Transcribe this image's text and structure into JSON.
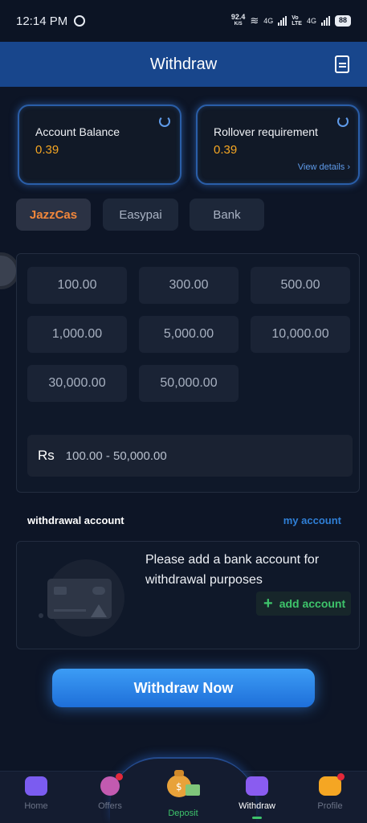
{
  "status_bar": {
    "time": "12:14 PM",
    "speed_value": "92.4",
    "speed_unit": "K/S",
    "net1": "4G",
    "net2_top": "Vo",
    "net2_bottom": "LTE",
    "net3": "4G",
    "battery": "88"
  },
  "header": {
    "title": "Withdraw"
  },
  "balances": {
    "account_label": "Account Balance",
    "account_value": "0.39",
    "rollover_label": "Rollover requirement",
    "rollover_value": "0.39",
    "view_details": "View details ›"
  },
  "methods": [
    "JazzCas",
    "Easypai",
    "Bank"
  ],
  "amounts": [
    "100.00",
    "300.00",
    "500.00",
    "1,000.00",
    "5,000.00",
    "10,000.00",
    "30,000.00",
    "50,000.00"
  ],
  "range": {
    "currency": "Rs",
    "text": "100.00 - 50,000.00"
  },
  "withdrawal_account": {
    "label": "withdrawal account",
    "link": "my account",
    "message": "Please add a bank account for withdrawal purposes",
    "add_button": "add account"
  },
  "cta": {
    "label": "Withdraw Now"
  },
  "nav": {
    "home": "Home",
    "offers": "Offers",
    "deposit": "Deposit",
    "withdraw": "Withdraw",
    "profile": "Profile"
  },
  "colors": {
    "accent": "#2f7fd6",
    "orange": "#f5a623",
    "green": "#3ec46b"
  }
}
